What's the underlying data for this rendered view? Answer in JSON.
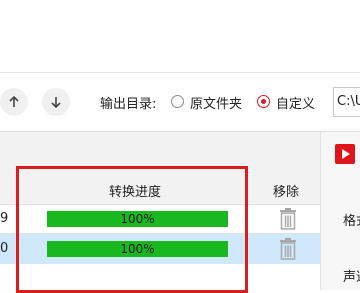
{
  "toolbar": {
    "output_dir_label": "输出目录:",
    "options": [
      {
        "label": "原文件夹",
        "selected": false
      },
      {
        "label": "自定义",
        "selected": true
      }
    ],
    "path_value": "C:\\U"
  },
  "table": {
    "headers": {
      "progress": "转换进度",
      "remove": "移除"
    },
    "rows": [
      {
        "index_fragment": "9",
        "progress": 1.0,
        "progress_text": "100%",
        "selected": false
      },
      {
        "index_fragment": "0",
        "progress": 1.0,
        "progress_text": "100%",
        "selected": true
      }
    ]
  },
  "side_panel": {
    "label_1": "格式",
    "label_2": "声道"
  },
  "colors": {
    "accent": "#d21f26",
    "progress_fill": "#19b81e",
    "selected_row": "#cfe9fb",
    "highlight_frame": "#d81e1e"
  }
}
